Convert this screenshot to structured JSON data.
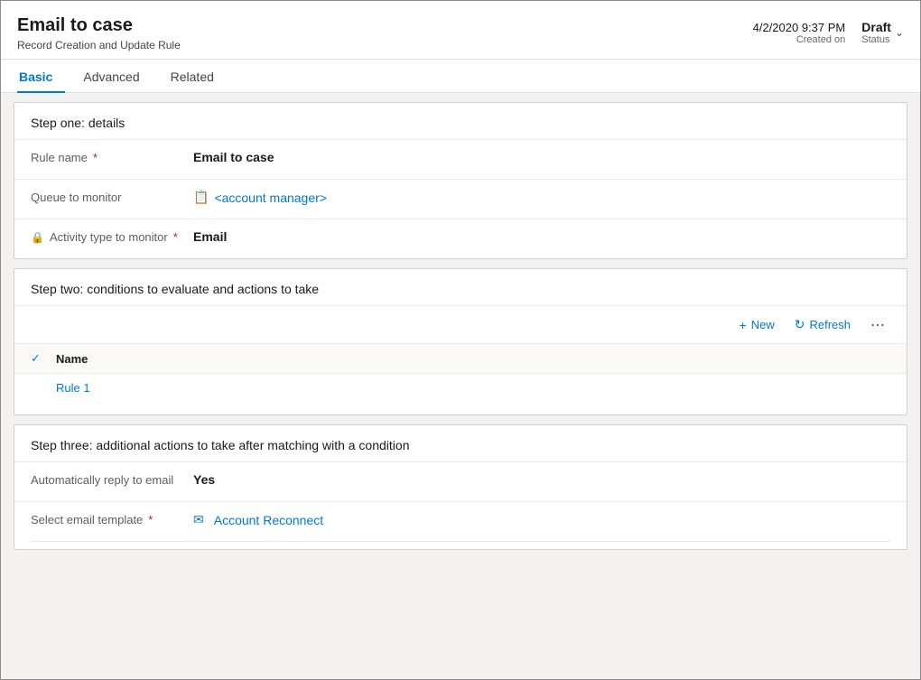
{
  "header": {
    "title": "Email to case",
    "subtitle": "Record Creation and Update Rule",
    "date": "4/2/2020 9:37 PM",
    "created_label": "Created on",
    "status_value": "Draft",
    "status_label": "Status"
  },
  "tabs": [
    {
      "label": "Basic",
      "active": true
    },
    {
      "label": "Advanced",
      "active": false
    },
    {
      "label": "Related",
      "active": false
    }
  ],
  "step_one": {
    "title": "Step one: details",
    "fields": [
      {
        "label": "Rule name",
        "required": true,
        "value": "Email to case",
        "type": "text"
      },
      {
        "label": "Queue to monitor",
        "required": false,
        "value": "<account manager>",
        "type": "link",
        "icon": "queue-icon"
      },
      {
        "label": "Activity type to monitor",
        "required": true,
        "value": "Email",
        "type": "text",
        "has_lock": true
      }
    ]
  },
  "step_two": {
    "title": "Step two: conditions to evaluate and actions to take",
    "actions": {
      "new_label": "New",
      "refresh_label": "Refresh"
    },
    "table": {
      "col_name": "Name",
      "rows": [
        {
          "name": "Rule 1"
        }
      ]
    }
  },
  "step_three": {
    "title": "Step three: additional actions to take after matching with a condition",
    "fields": [
      {
        "label": "Automatically reply to email",
        "required": false,
        "value": "Yes",
        "type": "bold"
      },
      {
        "label": "Select email template",
        "required": true,
        "value": "Account Reconnect",
        "type": "link"
      }
    ]
  },
  "icons": {
    "plus": "+",
    "refresh": "↻",
    "chevron_down": "∨",
    "more": "···",
    "checkmark": "✓",
    "lock": "🔒",
    "queue": "📋",
    "email_template": "✉"
  }
}
